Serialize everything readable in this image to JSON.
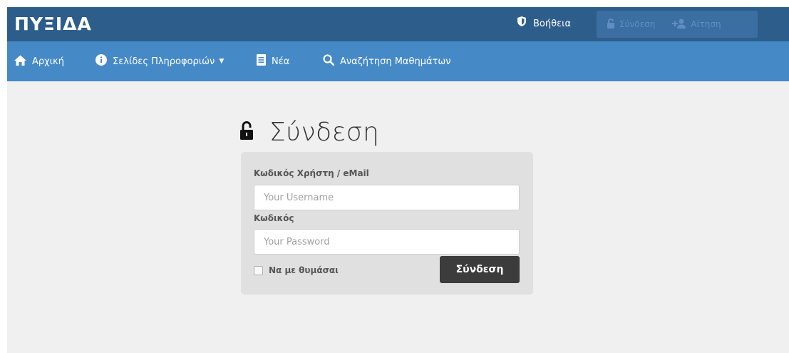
{
  "header": {
    "brand": "ΠΥΞΙΔΑ",
    "help_label": "Βοήθεια",
    "login_label": "Σύνδεση",
    "request_label": "Αίτηση"
  },
  "nav": {
    "items": [
      {
        "label": "Αρχική",
        "icon": "home-icon"
      },
      {
        "label": "Σελίδες Πληροφοριών",
        "icon": "info-icon",
        "dropdown": true
      },
      {
        "label": "Νέα",
        "icon": "news-icon"
      },
      {
        "label": "Αναζήτηση Μαθημάτων",
        "icon": "search-icon"
      }
    ]
  },
  "login": {
    "title": "Σύνδεση",
    "username_label": "Κωδικός Χρήστη / eMail",
    "username_placeholder": "Your Username",
    "password_label": "Κωδικός",
    "password_placeholder": "Your Password",
    "remember_label": "Να με θυμάσαι",
    "submit_label": "Σύνδεση"
  },
  "colors": {
    "topbar": "#2d5d8b",
    "navbar": "#4589c6",
    "button": "#3c3c3c",
    "panel": "#e0e0e0"
  }
}
